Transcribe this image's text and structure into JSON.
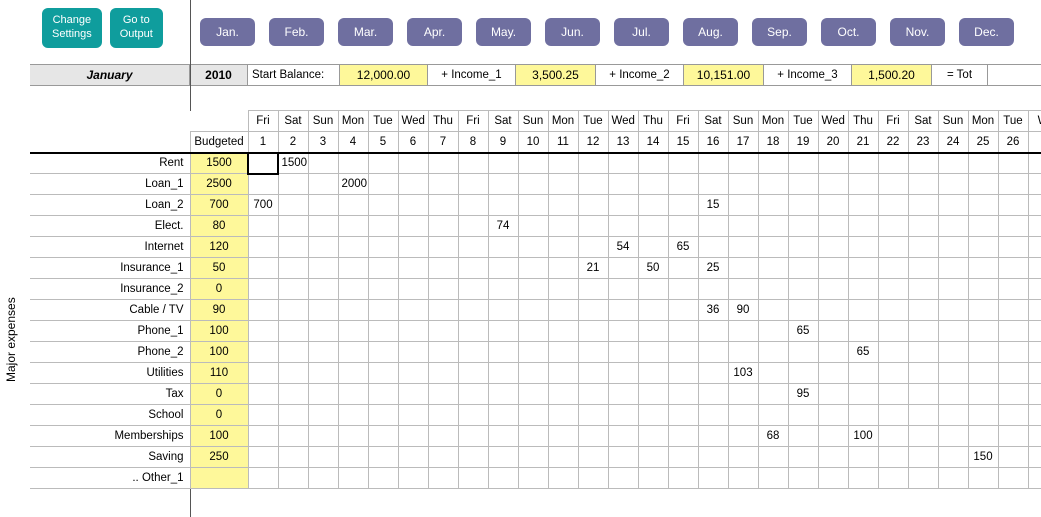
{
  "buttons": {
    "settings": "Change\nSettings",
    "output": "Go to\nOutput"
  },
  "months": [
    "Jan.",
    "Feb.",
    "Mar.",
    "Apr.",
    "May.",
    "Jun.",
    "Jul.",
    "Aug.",
    "Sep.",
    "Oct.",
    "Nov.",
    "Dec."
  ],
  "summary": {
    "month": "January",
    "year": "2010",
    "sb_label": "Start Balance:",
    "sb_val": "12,000.00",
    "inc1_label": "+ Income_1",
    "inc1_val": "3,500.25",
    "inc2_label": "+ Income_2",
    "inc2_val": "10,151.00",
    "inc3_label": "+ Income_3",
    "inc3_val": "1,500.20",
    "tot_label": "= Tot"
  },
  "category_label": "Major expenses",
  "budget_header": "Budgeted",
  "dow": [
    "Fri",
    "Sat",
    "Sun",
    "Mon",
    "Tue",
    "Wed",
    "Thu",
    "Fri",
    "Sat",
    "Sun",
    "Mon",
    "Tue",
    "Wed",
    "Thu",
    "Fri",
    "Sat",
    "Sun",
    "Mon",
    "Tue",
    "Wed",
    "Thu",
    "Fri",
    "Sat",
    "Sun",
    "Mon",
    "Tue",
    "W"
  ],
  "daynum": [
    "1",
    "2",
    "3",
    "4",
    "5",
    "6",
    "7",
    "8",
    "9",
    "10",
    "11",
    "12",
    "13",
    "14",
    "15",
    "16",
    "17",
    "18",
    "19",
    "20",
    "21",
    "22",
    "23",
    "24",
    "25",
    "26",
    ""
  ],
  "rows": [
    {
      "name": "Rent",
      "budget": "1500",
      "cells": {
        "2": "1500"
      }
    },
    {
      "name": "Loan_1",
      "budget": "2500",
      "cells": {
        "4": "2000"
      }
    },
    {
      "name": "Loan_2",
      "budget": "700",
      "cells": {
        "1": "700",
        "16": "15"
      }
    },
    {
      "name": "Elect.",
      "budget": "80",
      "cells": {
        "9": "74"
      }
    },
    {
      "name": "Internet",
      "budget": "120",
      "cells": {
        "13": "54",
        "15": "65"
      }
    },
    {
      "name": "Insurance_1",
      "budget": "50",
      "cells": {
        "12": "21",
        "14": "50",
        "16": "25"
      }
    },
    {
      "name": "Insurance_2",
      "budget": "0",
      "cells": {}
    },
    {
      "name": "Cable / TV",
      "budget": "90",
      "cells": {
        "16": "36",
        "17": "90"
      }
    },
    {
      "name": "Phone_1",
      "budget": "100",
      "cells": {
        "19": "65"
      }
    },
    {
      "name": "Phone_2",
      "budget": "100",
      "cells": {
        "21": "65"
      }
    },
    {
      "name": "Utilities",
      "budget": "110",
      "cells": {
        "17": "103"
      }
    },
    {
      "name": "Tax",
      "budget": "0",
      "cells": {
        "19": "95"
      }
    },
    {
      "name": "School",
      "budget": "0",
      "cells": {}
    },
    {
      "name": "Memberships",
      "budget": "100",
      "cells": {
        "18": "68",
        "21": "100"
      }
    },
    {
      "name": "Saving",
      "budget": "250",
      "cells": {
        "25": "150"
      }
    },
    {
      "name": ".. Other_1",
      "budget": "",
      "cells": {}
    }
  ]
}
